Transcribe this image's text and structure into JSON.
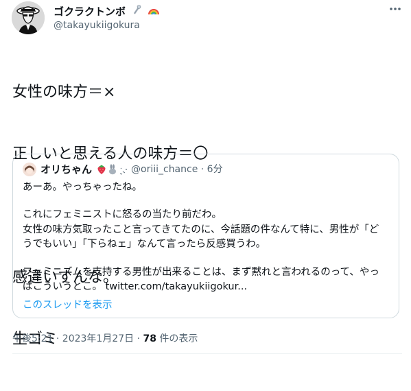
{
  "author": {
    "display_name": "ゴクラクトンボ",
    "handle": "@takayukiigokura"
  },
  "tweet": {
    "lines": [
      "女性の味方＝×",
      "正しいと思える人の味方＝〇",
      "",
      "感違いすんな。",
      "生ゴミ"
    ]
  },
  "quote": {
    "display_name": "オリちゃん",
    "handle_time": "@oriii_chance · 6分",
    "lines": [
      "あーあ。やっちゃったね。",
      "",
      "これにフェミニストに怒るの当たり前だわ。",
      "女性の味方気取ったこと言ってきてたのに、今話題の件なんて特に、男性が「ど",
      "うでもいい」「下らねェ」なんて言ったら反感買うわ。",
      "",
      "フェミニズムを支持する男性が出来ることは、まず黙れと言われるのって、やっ",
      "ぱこういうとこ。 twitter.com/takayukiigokur..."
    ],
    "thread_link": "このスレッドを表示"
  },
  "meta": {
    "time_date": "午後5:21 · 2023年1月27日 · ",
    "views_count": "78",
    "views_label": " 件の表示"
  },
  "colors": {
    "accent": "#1d9bf0",
    "secondary_text": "#536471",
    "border": "#cfd9de"
  }
}
